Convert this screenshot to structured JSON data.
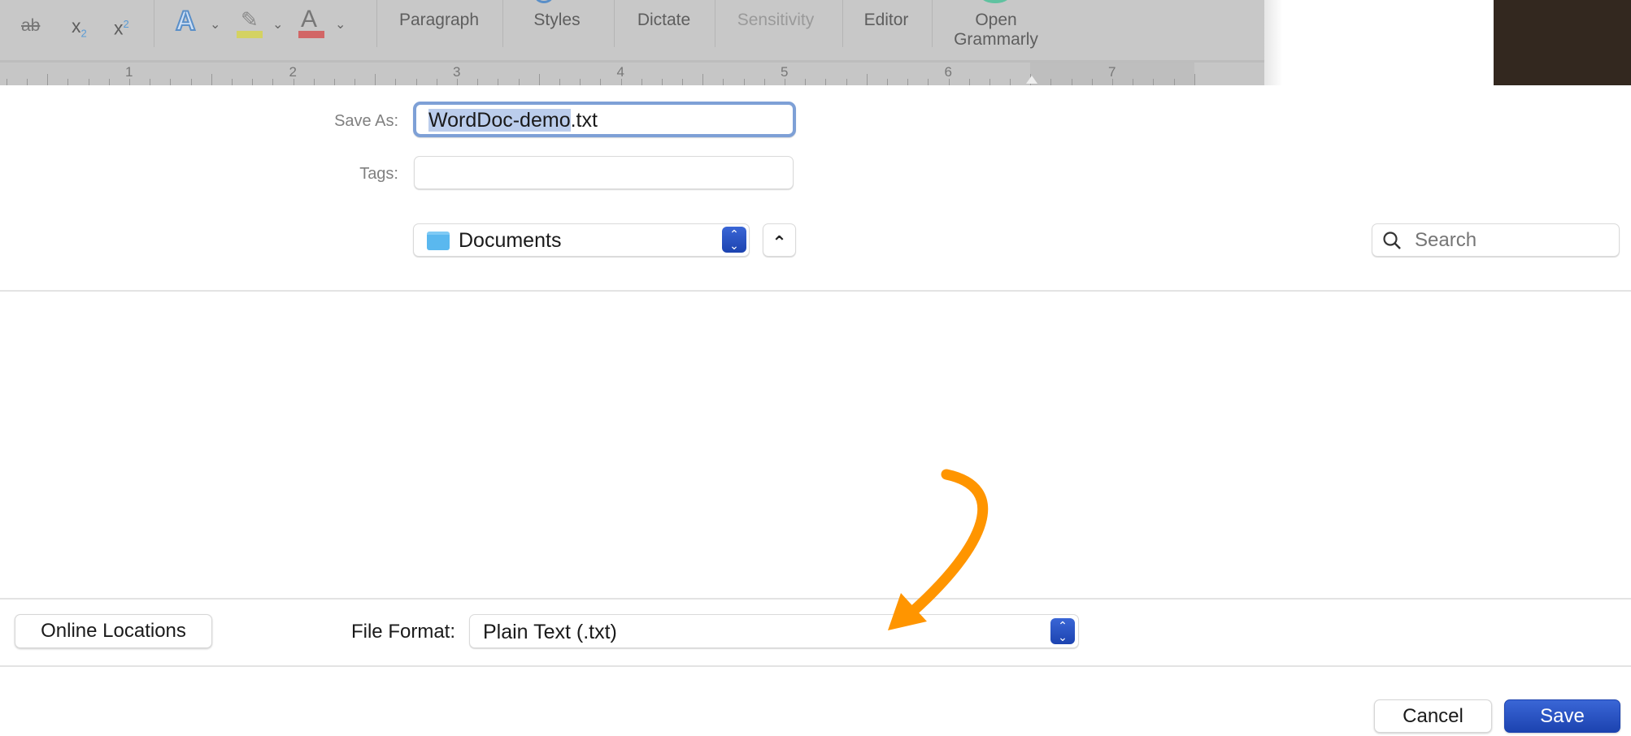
{
  "toolbar": {
    "format_icons": [
      "strikethrough-icon",
      "subscript-icon",
      "superscript-icon",
      "text-effects-icon",
      "highlighter-icon",
      "font-color-icon"
    ],
    "strike": "ab",
    "sub": "x",
    "sub_idx": "2",
    "sup": "x",
    "sup_idx": "2",
    "effects": "A",
    "color_a": "A",
    "highlight_color": "#d4d262",
    "font_color": "#d26666",
    "groups": [
      {
        "label": "Paragraph"
      },
      {
        "label": "Styles"
      },
      {
        "label": "Dictate"
      },
      {
        "label": "Sensitivity",
        "disabled": true
      },
      {
        "label": "Editor"
      },
      {
        "label": "Open Grammarly"
      }
    ]
  },
  "ruler": {
    "numbers": [
      "1",
      "2",
      "3",
      "4",
      "5",
      "6",
      "7"
    ]
  },
  "dialog": {
    "save_as_label": "Save As:",
    "save_as_value": "WordDoc-demo.txt",
    "save_as_selected": "WordDoc-demo",
    "save_as_ext": ".txt",
    "tags_label": "Tags:",
    "tags_value": "",
    "location": "Documents",
    "search_placeholder": "Search",
    "online_locations": "Online Locations",
    "file_format_label": "File Format:",
    "file_format_value": "Plain Text (.txt)",
    "cancel": "Cancel",
    "save": "Save"
  },
  "colors": {
    "accent": "#1f4fbf",
    "focus_ring": "#7ea0d6",
    "selection": "#bbcdec",
    "annotation_arrow": "#ff9500"
  }
}
